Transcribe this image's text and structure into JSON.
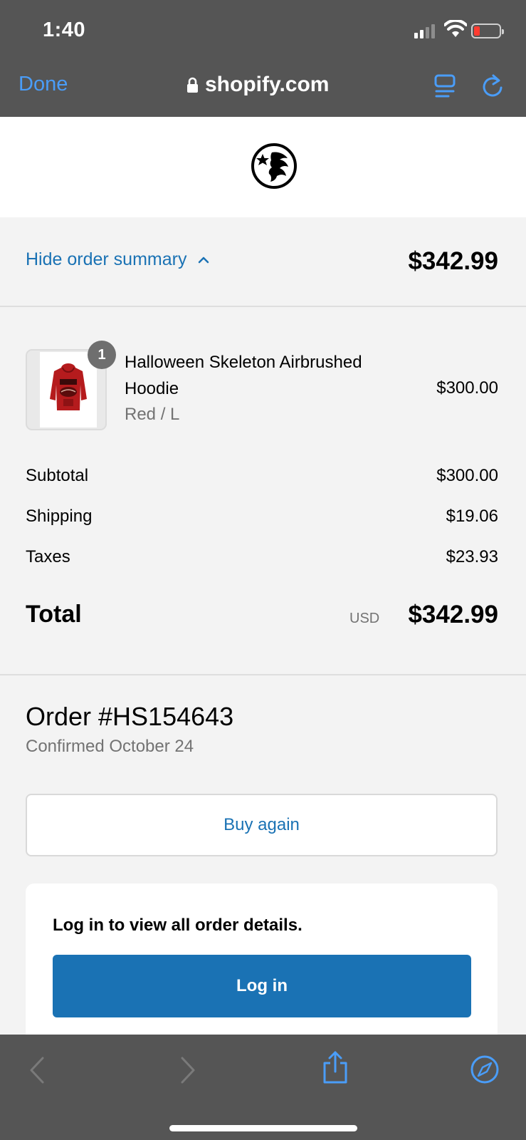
{
  "status_bar": {
    "time": "1:40"
  },
  "browser": {
    "done_label": "Done",
    "domain": "shopify.com",
    "accent_color": "#4a9df8"
  },
  "summary": {
    "toggle_label": "Hide order summary",
    "total": "$342.99"
  },
  "line_item": {
    "quantity": "1",
    "name": "Halloween Skeleton Airbrushed Hoodie",
    "variant": "Red / L",
    "price": "$300.00"
  },
  "costs": {
    "subtotal_label": "Subtotal",
    "subtotal": "$300.00",
    "shipping_label": "Shipping",
    "shipping": "$19.06",
    "taxes_label": "Taxes",
    "taxes": "$23.93",
    "total_label": "Total",
    "currency": "USD",
    "total": "$342.99"
  },
  "order": {
    "number": "Order #HS154643",
    "status": "Confirmed October 24"
  },
  "actions": {
    "buy_again": "Buy again",
    "login_prompt": "Log in to view all order details.",
    "login": "Log in"
  },
  "colors": {
    "link": "#1a72b4",
    "chrome": "#555555",
    "background": "#f3f3f3"
  }
}
